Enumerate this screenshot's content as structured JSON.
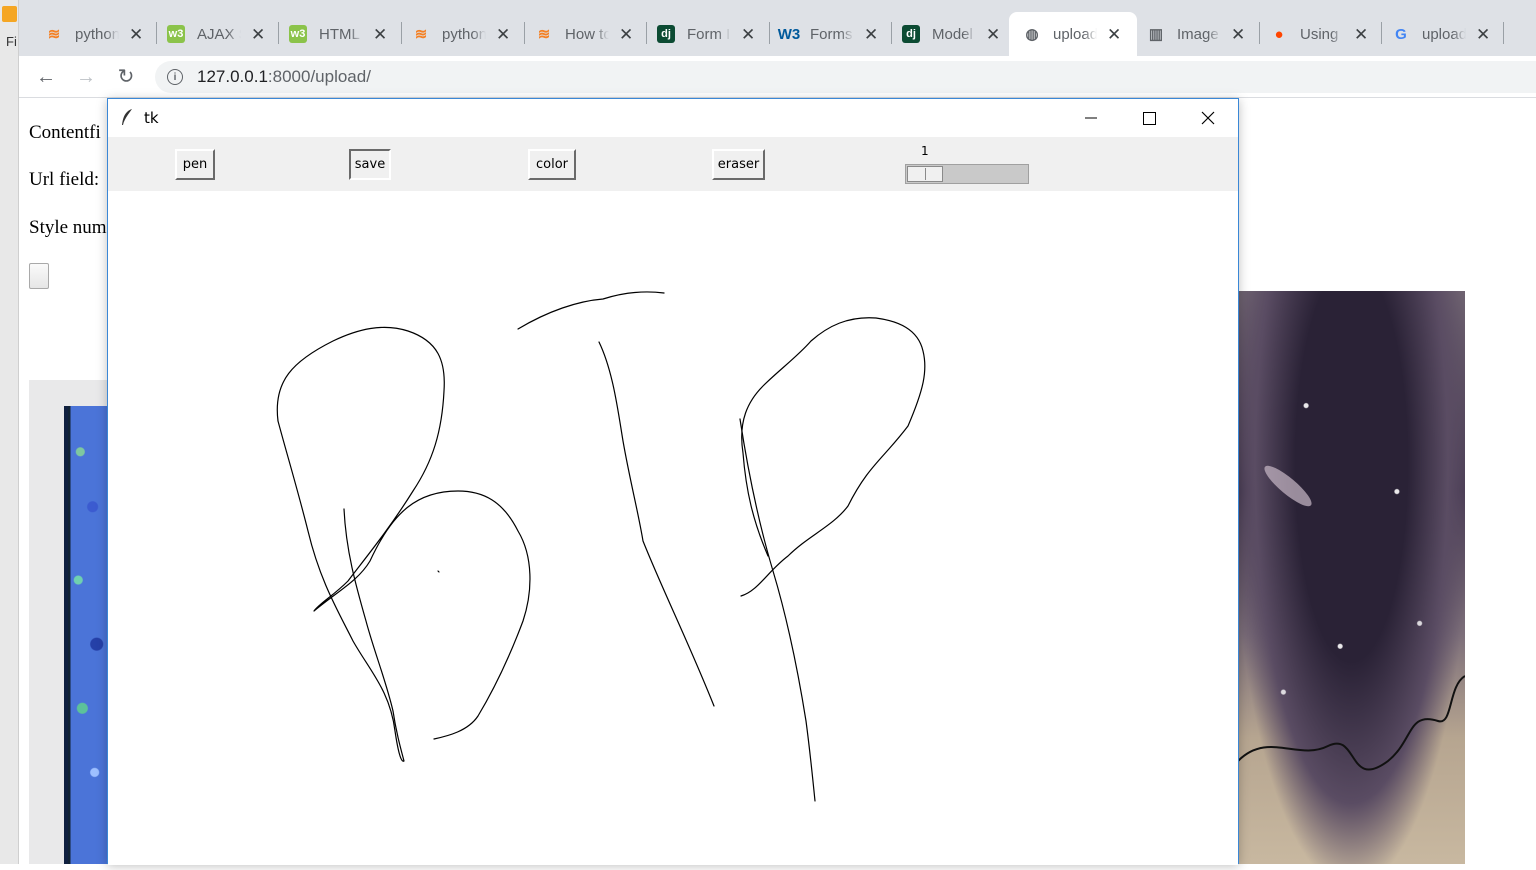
{
  "left_app": {
    "letter": "Fi"
  },
  "tabs": [
    {
      "title": "python",
      "icon": "stackoverflow-icon",
      "color": "#f48024",
      "glyph": "≋",
      "active": false
    },
    {
      "title": "AJAX S",
      "icon": "w3schools-icon",
      "color": "#8bc34a",
      "glyph": "w3",
      "active": false
    },
    {
      "title": "HTML",
      "icon": "w3schools-icon",
      "color": "#8bc34a",
      "glyph": "w3",
      "active": false
    },
    {
      "title": "python",
      "icon": "stackoverflow-icon",
      "color": "#f48024",
      "glyph": "≋",
      "active": false
    },
    {
      "title": "How to",
      "icon": "stackoverflow-icon",
      "color": "#f48024",
      "glyph": "≋",
      "active": false
    },
    {
      "title": "Form I",
      "icon": "django-icon",
      "color": "#0c4b33",
      "glyph": "dj",
      "active": false
    },
    {
      "title": "Forms",
      "icon": "w3c-icon",
      "color": "#005a9c",
      "glyph": "W3",
      "active": false
    },
    {
      "title": "Model",
      "icon": "django-icon",
      "color": "#0c4b33",
      "glyph": "dj",
      "active": false
    },
    {
      "title": "upload",
      "icon": "globe-icon",
      "color": "#5f6368",
      "glyph": "◍",
      "active": true
    },
    {
      "title": "Image",
      "icon": "docs-icon",
      "color": "#5f6368",
      "glyph": "▥",
      "active": false
    },
    {
      "title": "Using",
      "icon": "reddit-icon",
      "color": "#ff4500",
      "glyph": "●",
      "active": false
    },
    {
      "title": "upload",
      "icon": "google-icon",
      "color": "#4285f4",
      "glyph": "G",
      "active": false
    }
  ],
  "address_bar": {
    "host": "127.0.0.1",
    "rest": ":8000/upload/"
  },
  "page": {
    "labels": [
      "Contentfi",
      "Url field:",
      "Style num"
    ]
  },
  "tk_window": {
    "title": "tk",
    "buttons": [
      {
        "label": "pen",
        "pressed": false
      },
      {
        "label": "save",
        "pressed": true
      },
      {
        "label": "color",
        "pressed": false
      },
      {
        "label": "eraser",
        "pressed": false
      }
    ],
    "scale": {
      "value": "1",
      "min": 1,
      "max": 10,
      "level": 1
    },
    "ink_color": "#000000"
  }
}
